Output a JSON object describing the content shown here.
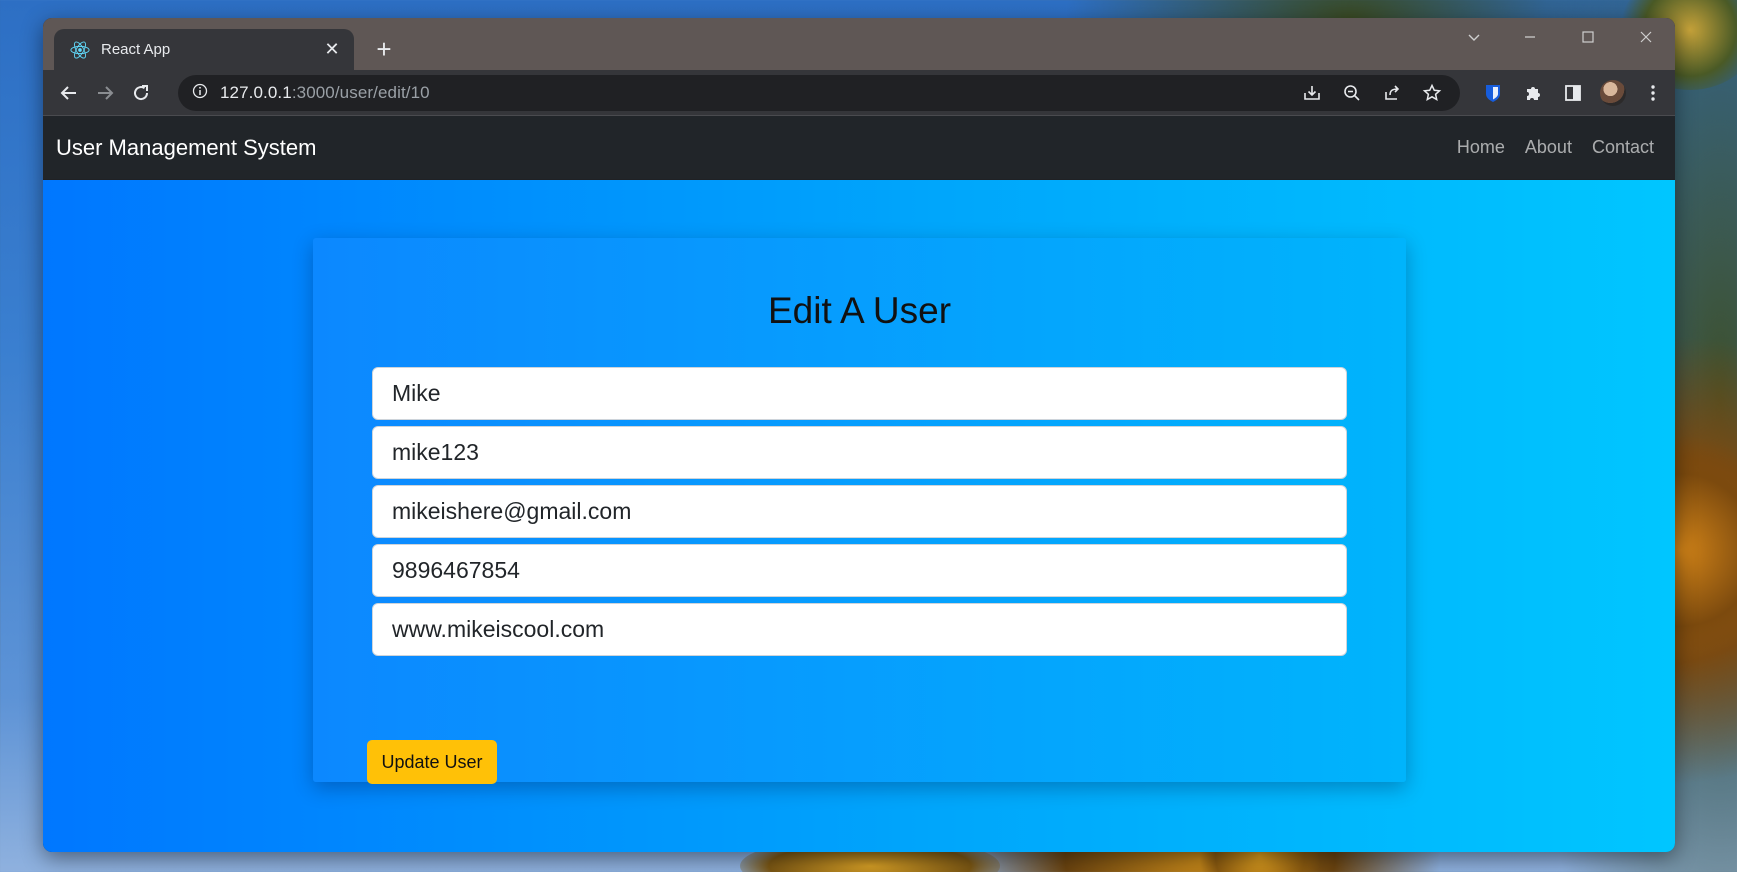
{
  "browser": {
    "tab_title": "React App",
    "tab_favicon": "react-logo-icon",
    "url_host": "127.0.0.1",
    "url_rest": ":3000/user/edit/10"
  },
  "navbar": {
    "brand": "User Management System",
    "links": [
      "Home",
      "About",
      "Contact"
    ]
  },
  "form": {
    "title": "Edit A User",
    "fields": [
      {
        "name": "name",
        "value": "Mike"
      },
      {
        "name": "username",
        "value": "mike123"
      },
      {
        "name": "email",
        "value": "mikeishere@gmail.com"
      },
      {
        "name": "phone",
        "value": "9896467854"
      },
      {
        "name": "website",
        "value": "www.mikeiscool.com"
      }
    ],
    "submit_label": "Update User"
  },
  "colors": {
    "navbar_bg": "#212529",
    "button_bg": "#ffc107",
    "gradient_start": "#0077ff",
    "gradient_end": "#00c6ff"
  }
}
